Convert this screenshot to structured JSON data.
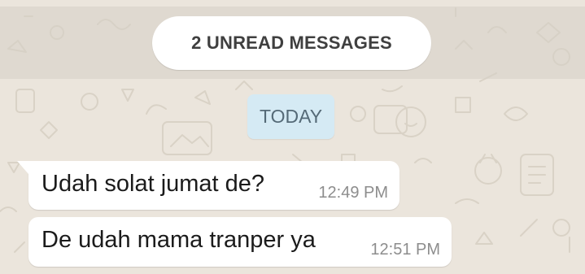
{
  "unread_banner": {
    "label": "2 UNREAD MESSAGES"
  },
  "date_separator": {
    "label": "TODAY"
  },
  "messages": [
    {
      "text": "Udah solat jumat de?",
      "time": "12:49 PM"
    },
    {
      "text": "De udah mama tranper ya",
      "time": "12:51 PM"
    }
  ],
  "colors": {
    "chat_background": "#ebe5dc",
    "bubble": "#ffffff",
    "date_chip": "#d5eaf4",
    "timestamp": "#8d8d8d"
  }
}
